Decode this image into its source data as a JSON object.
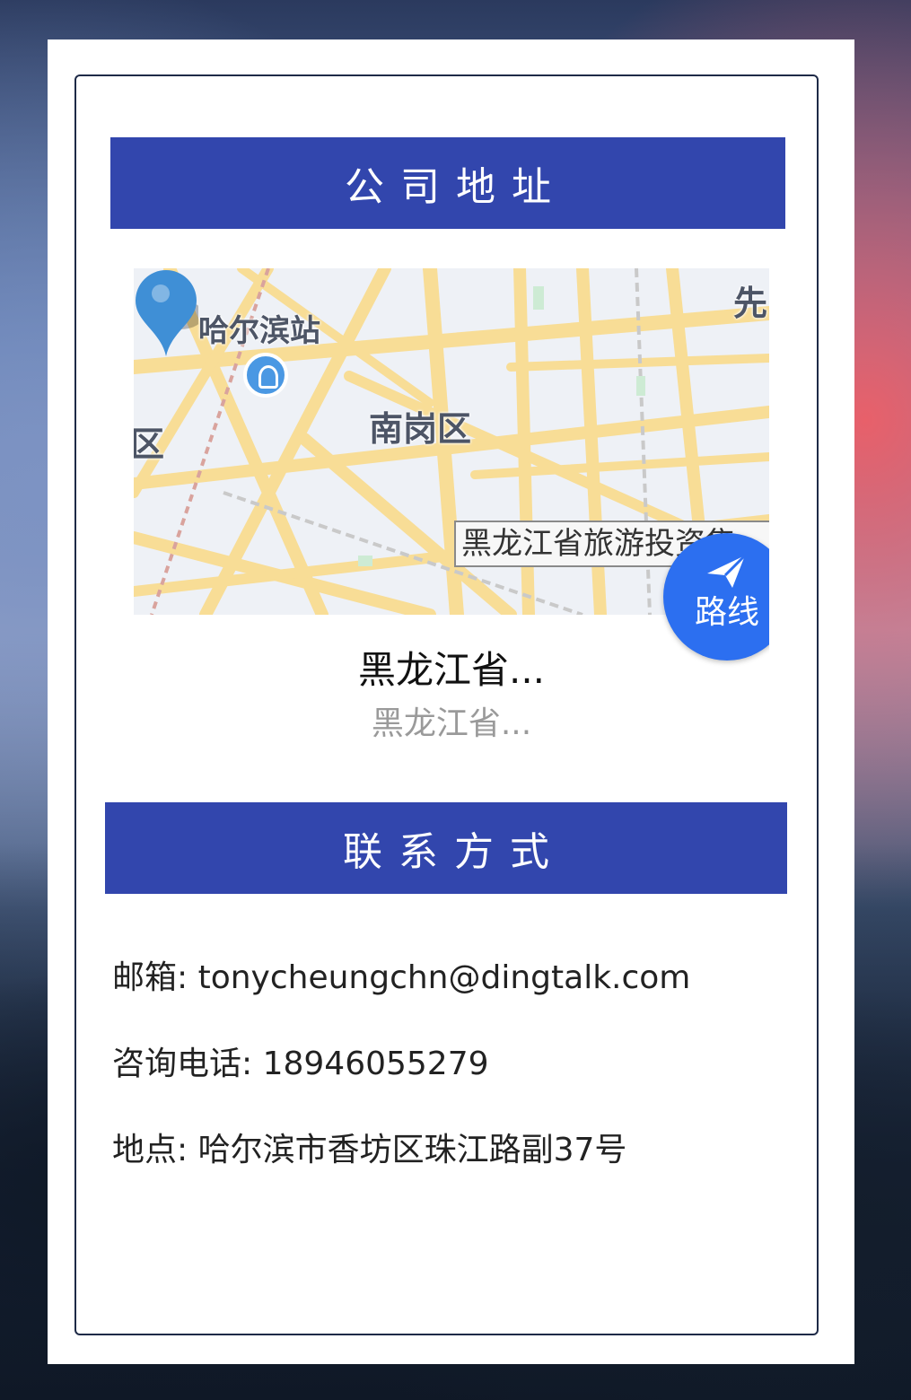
{
  "sections": {
    "address_title": "公司地址",
    "contact_title": "联系方式"
  },
  "map": {
    "labels": {
      "station": "哈尔滨站",
      "district": "南岗区",
      "edge_left": "区",
      "edge_top": "先"
    },
    "poi_callout": "黑龙江省旅游投资集",
    "route_button_label": "路线",
    "route_button_icon": "send-icon",
    "place_name": "黑龙江省...",
    "place_address": "黑龙江省..."
  },
  "contact": {
    "email": "邮箱: tonycheungchn@dingtalk.com",
    "phone": "咨询电话: 18946055279",
    "location": "地点: 哈尔滨市香坊区珠江路副37号"
  },
  "colors": {
    "banner": "#3246ad",
    "route_button": "#2c6ff0",
    "frame_border": "#1e2a47"
  }
}
